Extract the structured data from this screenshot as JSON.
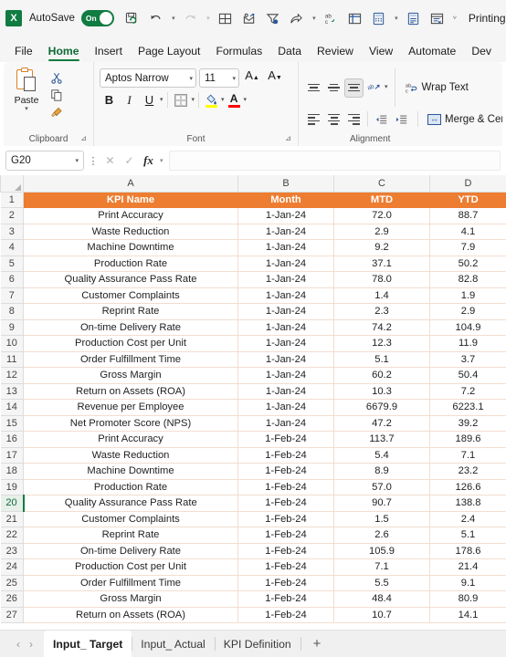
{
  "titlebar": {
    "app_logo": "excel-logo",
    "app_logo_letter": "X",
    "autosave_label": "AutoSave",
    "autosave_state": "On",
    "printing_label": "Printing",
    "qat_items": [
      {
        "name": "save-icon",
        "glyph": "💾"
      },
      {
        "name": "undo-icon",
        "glyph": "↶"
      },
      {
        "name": "redo-icon",
        "glyph": "↷"
      },
      {
        "name": "table-icon",
        "glyph": "⊞"
      },
      {
        "name": "open-envelope-icon",
        "glyph": "✉"
      },
      {
        "name": "filter-icon",
        "glyph": "ᐱ"
      },
      {
        "name": "share-icon",
        "glyph": "➦"
      },
      {
        "name": "spelling-icon",
        "glyph": "ab"
      },
      {
        "name": "freeze-panes-icon",
        "glyph": "▦"
      },
      {
        "name": "calculator-icon",
        "glyph": "▤"
      },
      {
        "name": "calculate-sheet-icon",
        "glyph": "▥"
      },
      {
        "name": "form-icon",
        "glyph": "▧"
      },
      {
        "name": "customize-qat-icon",
        "glyph": "⌵"
      }
    ]
  },
  "ribbon_tabs": [
    {
      "label": "File",
      "active": false
    },
    {
      "label": "Home",
      "active": true
    },
    {
      "label": "Insert",
      "active": false
    },
    {
      "label": "Page Layout",
      "active": false
    },
    {
      "label": "Formulas",
      "active": false
    },
    {
      "label": "Data",
      "active": false
    },
    {
      "label": "Review",
      "active": false
    },
    {
      "label": "View",
      "active": false
    },
    {
      "label": "Automate",
      "active": false
    },
    {
      "label": "Dev",
      "active": false
    }
  ],
  "ribbon": {
    "clipboard": {
      "group_label": "Clipboard",
      "paste_label": "Paste",
      "cut_icon": "scissors-icon",
      "copy_icon": "copy-icon",
      "format_painter_icon": "format-painter-icon"
    },
    "font": {
      "group_label": "Font",
      "font_name": "Aptos Narrow",
      "font_size": "11",
      "grow_font": "A",
      "shrink_font": "A",
      "bold": "B",
      "italic": "I",
      "underline": "U",
      "borders_icon": "borders-icon",
      "fill_color_icon": "fill-color-icon",
      "font_color_icon": "font-color-icon",
      "fill_color_hex": "#FFFF00",
      "font_color_hex": "#FF0000"
    },
    "alignment": {
      "group_label": "Alignment",
      "wrap_text_label": "Wrap Text",
      "merge_center_label": "Merge & Cente",
      "align_top": "align-top-icon",
      "align_middle": "align-middle-icon",
      "align_bottom": "align-bottom-icon",
      "orientation": "orientation-icon",
      "align_left": "align-left-icon",
      "align_center": "align-center-icon",
      "align_right": "align-right-icon",
      "decrease_indent": "decrease-indent-icon",
      "increase_indent": "increase-indent-icon"
    }
  },
  "formula_bar": {
    "name_box": "G20",
    "formula_value": "",
    "cancel_icon": "cancel-icon",
    "enter_icon": "confirm-icon",
    "fx_label": "fx"
  },
  "sheet": {
    "column_headers": [
      "A",
      "B",
      "C",
      "D"
    ],
    "active_row": 20,
    "header_fill": "#ED7D31",
    "header_text_color": "#FFFFFF",
    "columns": [
      "KPI Name",
      "Month",
      "MTD",
      "YTD"
    ],
    "rows": [
      {
        "num": 1,
        "cells": [
          "KPI Name",
          "Month",
          "MTD",
          "YTD"
        ],
        "header": true
      },
      {
        "num": 2,
        "cells": [
          "Print Accuracy",
          "1-Jan-24",
          "72.0",
          "88.7"
        ]
      },
      {
        "num": 3,
        "cells": [
          "Waste Reduction",
          "1-Jan-24",
          "2.9",
          "4.1"
        ]
      },
      {
        "num": 4,
        "cells": [
          "Machine Downtime",
          "1-Jan-24",
          "9.2",
          "7.9"
        ]
      },
      {
        "num": 5,
        "cells": [
          "Production Rate",
          "1-Jan-24",
          "37.1",
          "50.2"
        ]
      },
      {
        "num": 6,
        "cells": [
          "Quality Assurance Pass Rate",
          "1-Jan-24",
          "78.0",
          "82.8"
        ]
      },
      {
        "num": 7,
        "cells": [
          "Customer Complaints",
          "1-Jan-24",
          "1.4",
          "1.9"
        ]
      },
      {
        "num": 8,
        "cells": [
          "Reprint Rate",
          "1-Jan-24",
          "2.3",
          "2.9"
        ]
      },
      {
        "num": 9,
        "cells": [
          "On-time Delivery Rate",
          "1-Jan-24",
          "74.2",
          "104.9"
        ]
      },
      {
        "num": 10,
        "cells": [
          "Production Cost per Unit",
          "1-Jan-24",
          "12.3",
          "11.9"
        ]
      },
      {
        "num": 11,
        "cells": [
          "Order Fulfillment Time",
          "1-Jan-24",
          "5.1",
          "3.7"
        ]
      },
      {
        "num": 12,
        "cells": [
          "Gross Margin",
          "1-Jan-24",
          "60.2",
          "50.4"
        ]
      },
      {
        "num": 13,
        "cells": [
          "Return on Assets (ROA)",
          "1-Jan-24",
          "10.3",
          "7.2"
        ]
      },
      {
        "num": 14,
        "cells": [
          "Revenue per Employee",
          "1-Jan-24",
          "6679.9",
          "6223.1"
        ]
      },
      {
        "num": 15,
        "cells": [
          "Net Promoter Score (NPS)",
          "1-Jan-24",
          "47.2",
          "39.2"
        ]
      },
      {
        "num": 16,
        "cells": [
          "Print Accuracy",
          "1-Feb-24",
          "113.7",
          "189.6"
        ]
      },
      {
        "num": 17,
        "cells": [
          "Waste Reduction",
          "1-Feb-24",
          "5.4",
          "7.1"
        ]
      },
      {
        "num": 18,
        "cells": [
          "Machine Downtime",
          "1-Feb-24",
          "8.9",
          "23.2"
        ]
      },
      {
        "num": 19,
        "cells": [
          "Production Rate",
          "1-Feb-24",
          "57.0",
          "126.6"
        ]
      },
      {
        "num": 20,
        "cells": [
          "Quality Assurance Pass Rate",
          "1-Feb-24",
          "90.7",
          "138.8"
        ]
      },
      {
        "num": 21,
        "cells": [
          "Customer Complaints",
          "1-Feb-24",
          "1.5",
          "2.4"
        ]
      },
      {
        "num": 22,
        "cells": [
          "Reprint Rate",
          "1-Feb-24",
          "2.6",
          "5.1"
        ]
      },
      {
        "num": 23,
        "cells": [
          "On-time Delivery Rate",
          "1-Feb-24",
          "105.9",
          "178.6"
        ]
      },
      {
        "num": 24,
        "cells": [
          "Production Cost per Unit",
          "1-Feb-24",
          "7.1",
          "21.4"
        ]
      },
      {
        "num": 25,
        "cells": [
          "Order Fulfillment Time",
          "1-Feb-24",
          "5.5",
          "9.1"
        ]
      },
      {
        "num": 26,
        "cells": [
          "Gross Margin",
          "1-Feb-24",
          "48.4",
          "80.9"
        ]
      },
      {
        "num": 27,
        "cells": [
          "Return on Assets (ROA)",
          "1-Feb-24",
          "10.7",
          "14.1"
        ]
      }
    ]
  },
  "tabbar": {
    "prev_arrow": "‹",
    "next_arrow": "›",
    "add_sheet": "+",
    "sheets": [
      {
        "label": "Input_ Target",
        "active": true
      },
      {
        "label": "Input_ Actual",
        "active": false
      },
      {
        "label": "KPI Definition",
        "active": false
      }
    ]
  }
}
